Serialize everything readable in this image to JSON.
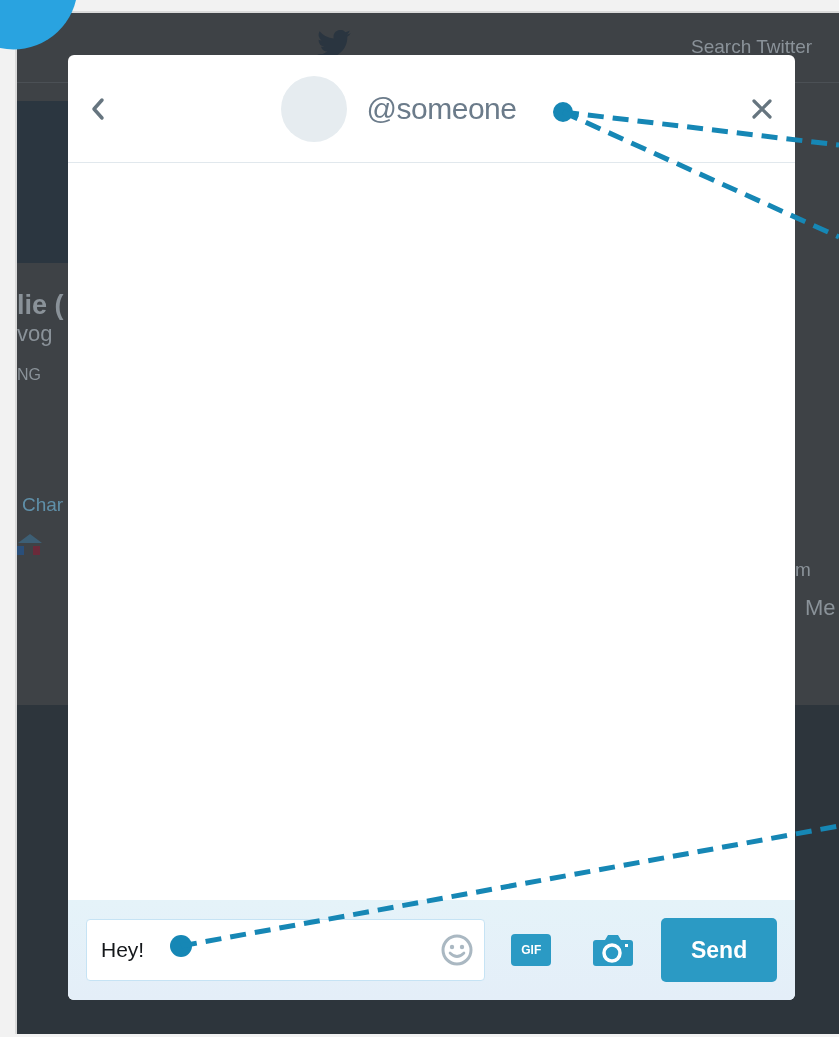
{
  "background_page": {
    "search_placeholder": "Search Twitter",
    "profile_name": "lie (",
    "profile_handle": "vog",
    "stat_label": "NG",
    "link_text": "Char",
    "side_text_1": "m",
    "side_text_2": "Me"
  },
  "dialog": {
    "handle": "@someone",
    "message_input": {
      "value": "Hey!"
    },
    "gif_label": "GIF",
    "send_button": "Send"
  }
}
